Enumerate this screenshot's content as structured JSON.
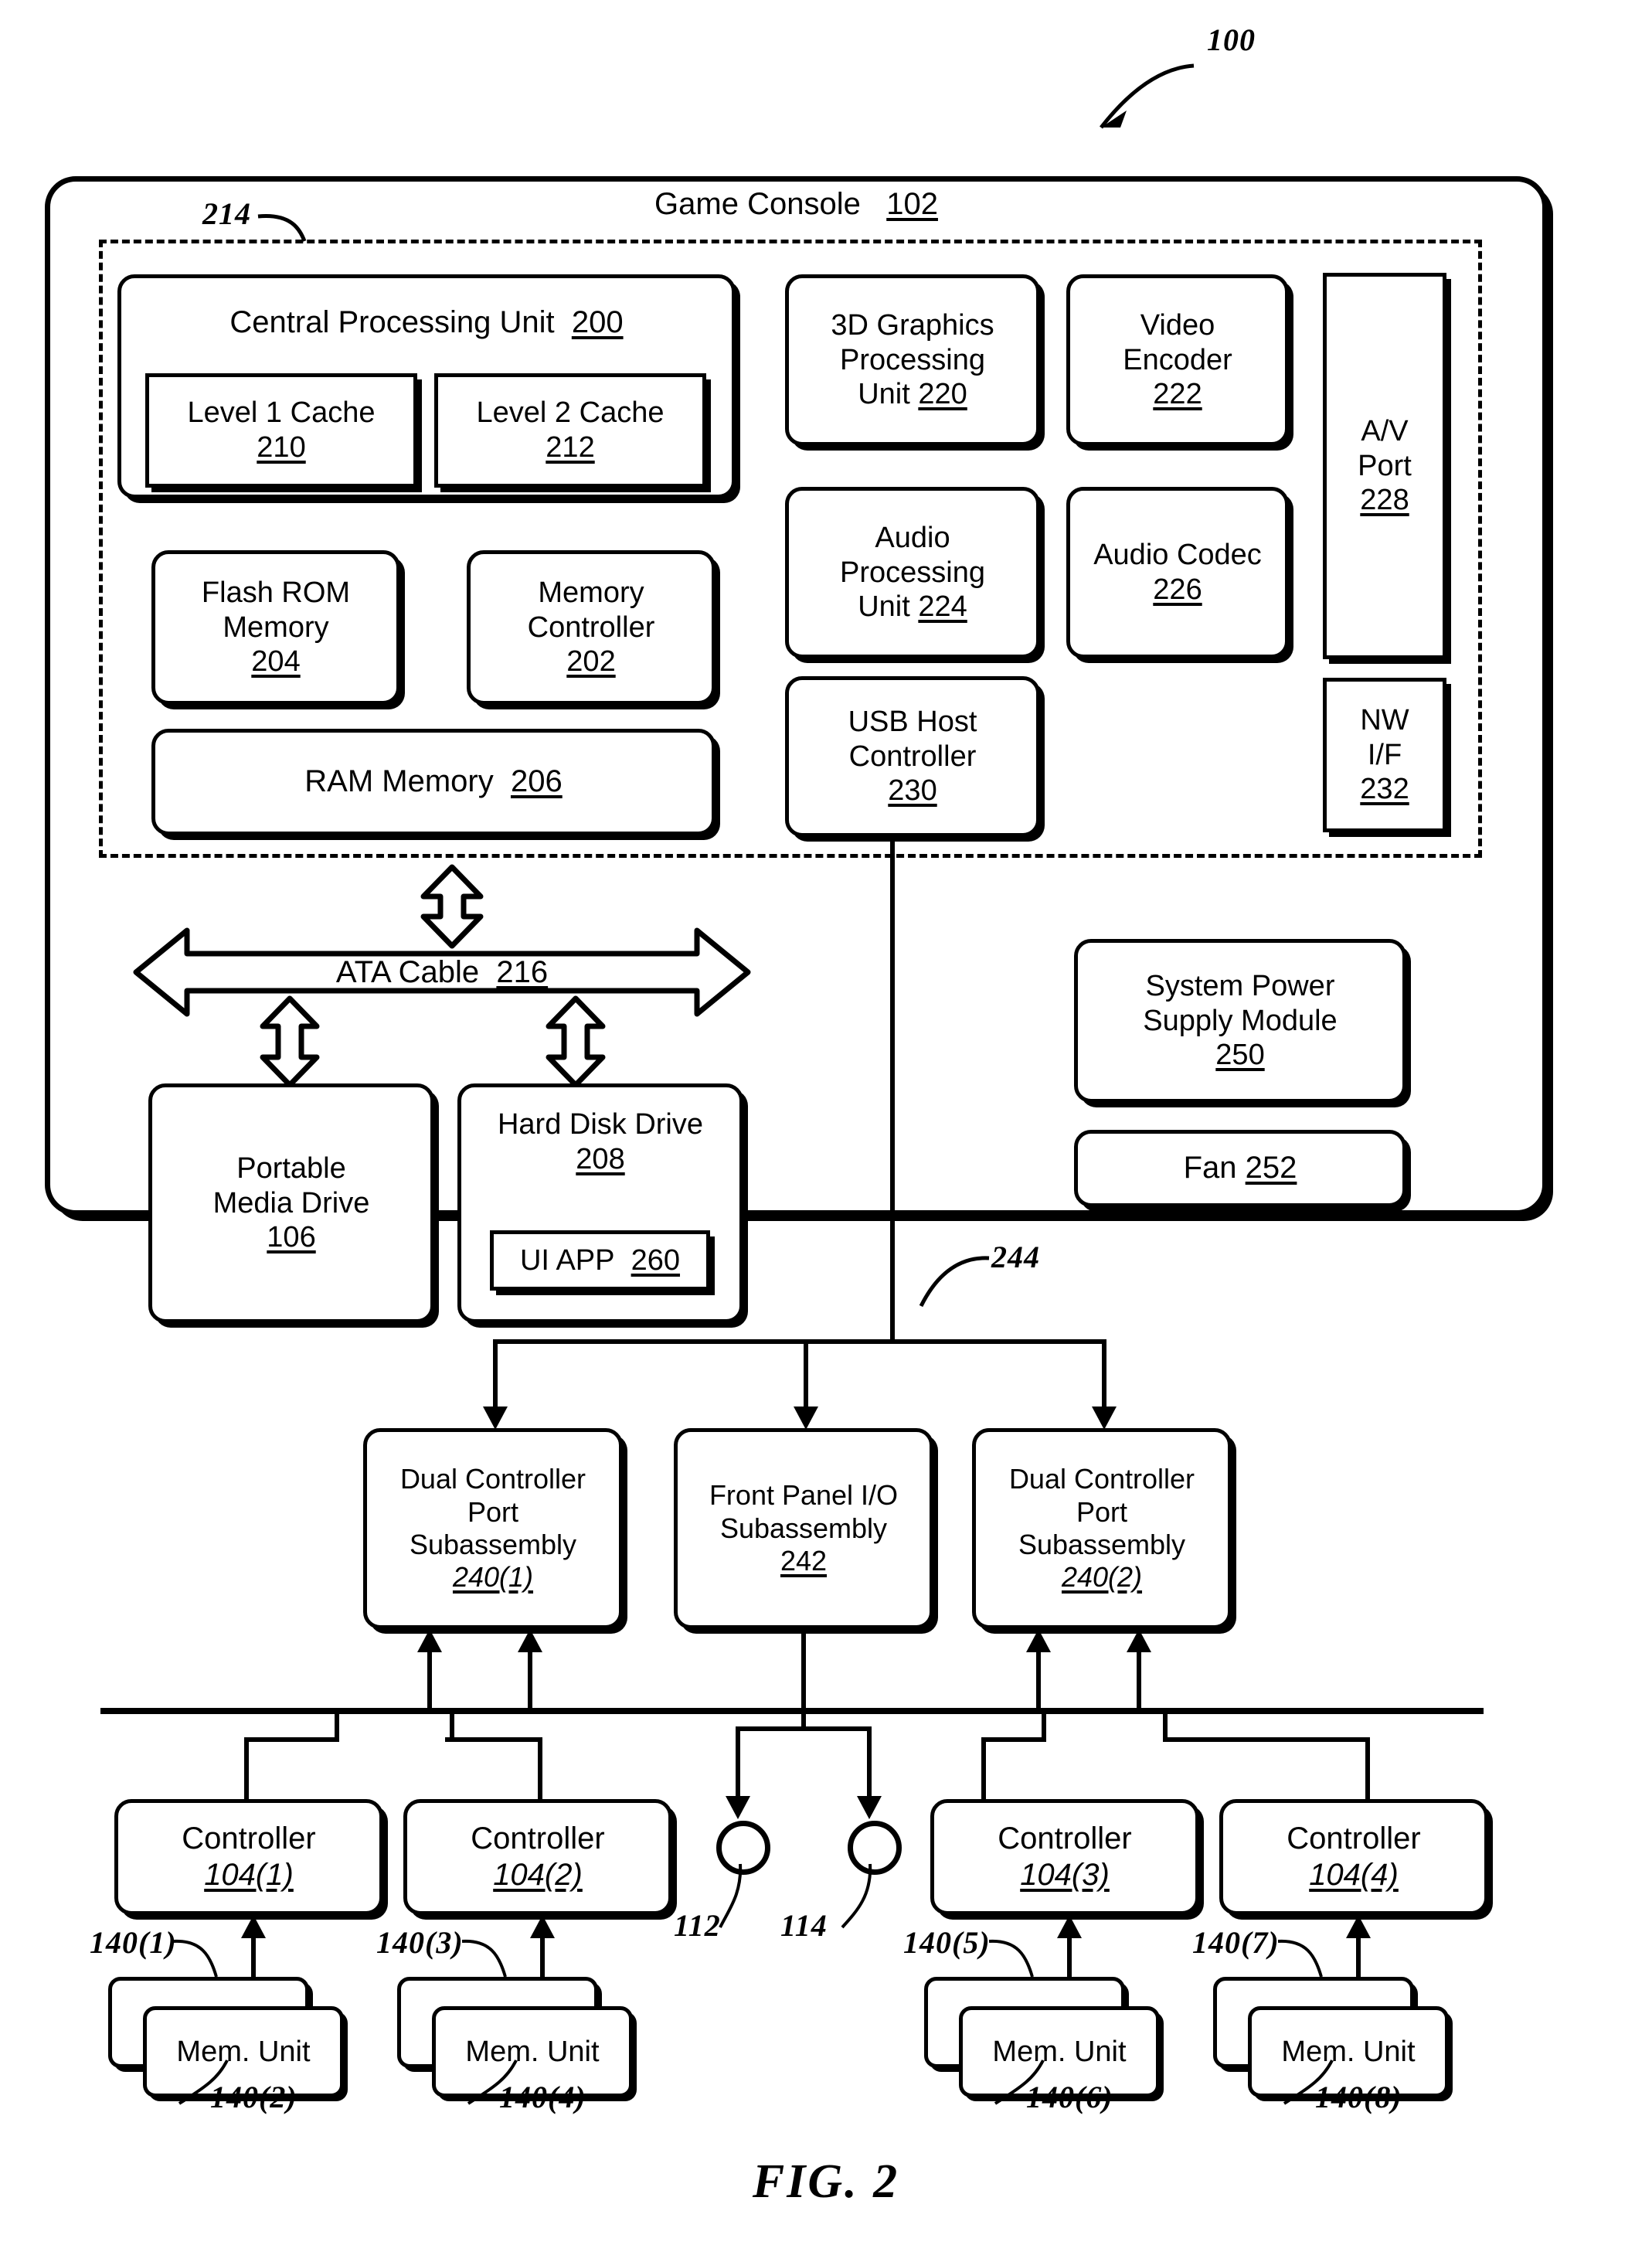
{
  "figure": {
    "caption": "FIG.  2",
    "system_ref": "100"
  },
  "console": {
    "title_text": "Game Console",
    "title_ref": "102",
    "board_ref": "214",
    "bus_ref": "244"
  },
  "cpu": {
    "title": "Central Processing Unit",
    "ref": "200",
    "caches": [
      {
        "label": "Level 1 Cache",
        "ref": "210"
      },
      {
        "label": "Level 2 Cache",
        "ref": "212"
      }
    ]
  },
  "memory_blocks": [
    {
      "line1": "Flash ROM",
      "line2": "Memory",
      "ref": "204"
    },
    {
      "line1": "Memory",
      "line2": "Controller",
      "ref": "202"
    }
  ],
  "ram": {
    "label": "RAM Memory",
    "ref": "206"
  },
  "media_blocks": [
    {
      "line1": "3D Graphics",
      "line2": "Processing",
      "line3": "Unit",
      "ref": "220"
    },
    {
      "line1": "Video",
      "line2": "Encoder",
      "ref": "222"
    },
    {
      "line1": "Audio",
      "line2": "Processing",
      "line3": "Unit",
      "ref": "224"
    },
    {
      "line1": "Audio Codec",
      "ref": "226"
    }
  ],
  "ports": [
    {
      "line1": "A/V",
      "line2": "Port",
      "ref": "228"
    },
    {
      "line1": "NW",
      "line2": "I/F",
      "ref": "232"
    }
  ],
  "usb_host": {
    "line1": "USB Host",
    "line2": "Controller",
    "ref": "230"
  },
  "ata_cable": {
    "label": "ATA Cable",
    "ref": "216"
  },
  "drives": {
    "portable": {
      "line1": "Portable",
      "line2": "Media Drive",
      "ref": "106"
    },
    "hdd": {
      "label": "Hard Disk Drive",
      "ref": "208"
    },
    "ui_app": {
      "label": "UI APP",
      "ref": "260"
    }
  },
  "power": {
    "supply": {
      "line1": "System Power",
      "line2": "Supply Module",
      "ref": "250"
    },
    "fan": {
      "label": "Fan",
      "ref": "252"
    }
  },
  "subassemblies": [
    {
      "line1": "Dual Controller",
      "line2": "Port",
      "line3": "Subassembly",
      "ref": "240(1)"
    },
    {
      "line1": "Front Panel I/O",
      "line2": "Subassembly",
      "ref": "242"
    },
    {
      "line1": "Dual Controller",
      "line2": "Port",
      "line3": "Subassembly",
      "ref": "240(2)"
    }
  ],
  "front_panel_ports": [
    {
      "ref": "112"
    },
    {
      "ref": "114"
    }
  ],
  "controllers": [
    {
      "label": "Controller",
      "ref": "104(1)",
      "mem_label": "Mem. Unit",
      "mem_ref_top": "140(1)",
      "mem_ref_bottom": "140(2)"
    },
    {
      "label": "Controller",
      "ref": "104(2)",
      "mem_label": "Mem. Unit",
      "mem_ref_top": "140(3)",
      "mem_ref_bottom": "140(4)"
    },
    {
      "label": "Controller",
      "ref": "104(3)",
      "mem_label": "Mem. Unit",
      "mem_ref_top": "140(5)",
      "mem_ref_bottom": "140(6)"
    },
    {
      "label": "Controller",
      "ref": "104(4)",
      "mem_label": "Mem. Unit",
      "mem_ref_top": "140(7)",
      "mem_ref_bottom": "140(8)"
    }
  ]
}
